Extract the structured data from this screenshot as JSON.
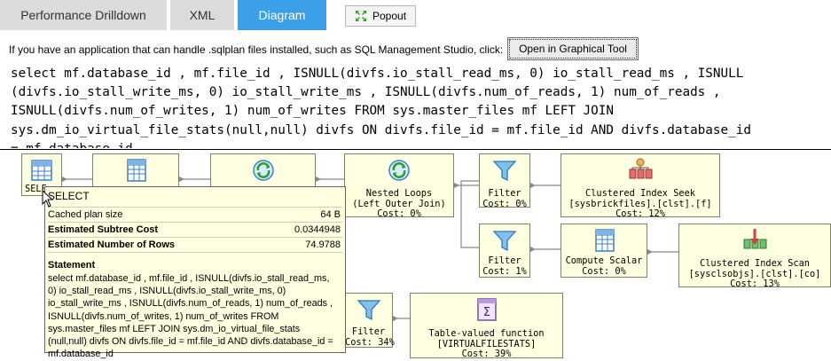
{
  "tabs": [
    {
      "label": "Performance Drilldown",
      "active": false
    },
    {
      "label": "XML",
      "active": false
    },
    {
      "label": "Diagram",
      "active": true
    }
  ],
  "popout": {
    "label": "Popout",
    "icon": "popout-arrows-icon"
  },
  "hint_text": "If you have an application that can handle .sqlplan files installed, such as SQL Management Studio, click:",
  "open_button": "Open in Graphical Tool",
  "sql_lines": [
    "select mf.database_id , mf.file_id , ISNULL(divfs.io_stall_read_ms, 0) io_stall_read_ms , ISNULL",
    "(divfs.io_stall_write_ms, 0) io_stall_write_ms , ISNULL(divfs.num_of_reads, 1) num_of_reads ,",
    "ISNULL(divfs.num_of_writes, 1) num_of_writes FROM sys.master_files mf LEFT JOIN",
    "sys.dm_io_virtual_file_stats(null,null) divfs ON divfs.file_id = mf.file_id AND divfs.database_id",
    "= mf.database_id"
  ],
  "nodes": {
    "select": {
      "lines": [
        "SELE"
      ],
      "icon": "select-icon"
    },
    "compute_top": {
      "lines": [],
      "icon": "compute-scalar-icon"
    },
    "merge_top": {
      "lines": [],
      "icon": "nested-loops-icon"
    },
    "nested_loops": {
      "lines": [
        "Nested Loops",
        "(Left Outer Join)",
        "Cost: 0%"
      ],
      "icon": "nested-loops-icon"
    },
    "filter_top": {
      "lines": [
        "Filter",
        "Cost: 0%"
      ],
      "icon": "filter-icon"
    },
    "ci_seek": {
      "lines": [
        "Clustered Index Seek",
        "[sysbrickfiles].[clst].[f]",
        "Cost: 12%"
      ],
      "icon": "clustered-index-seek-icon"
    },
    "filter_mid": {
      "lines": [
        "Filter",
        "Cost: 1%"
      ],
      "icon": "filter-icon"
    },
    "compute_scalar": {
      "lines": [
        "Compute Scalar",
        "Cost: 0%"
      ],
      "icon": "compute-scalar-icon"
    },
    "ci_scan": {
      "lines": [
        "Clustered Index Scan",
        "[sysclsobjs].[clst].[co]",
        "Cost: 13%"
      ],
      "icon": "clustered-index-scan-icon"
    },
    "filter_bottom": {
      "lines": [
        "Filter",
        "Cost: 34%"
      ],
      "icon": "filter-icon"
    },
    "tvf": {
      "lines": [
        "Table-valued function",
        "[VIRTUALFILESTATS]",
        "Cost: 39%"
      ],
      "icon": "table-valued-function-icon"
    }
  },
  "tooltip": {
    "title": "SELECT",
    "rows": [
      {
        "key": "Cached plan size",
        "value": "64 B"
      },
      {
        "key": "Estimated Subtree Cost",
        "value": "0.0344948"
      },
      {
        "key": "Estimated Number of Rows",
        "value": "74.9788"
      }
    ],
    "statement_heading": "Statement",
    "statement_lines": [
      "select mf.database_id , mf.file_id , ISNULL(divfs.io_stall_read_ms,",
      "0) io_stall_read_ms , ISNULL(divfs.io_stall_write_ms, 0)",
      "io_stall_write_ms , ISNULL(divfs.num_of_reads, 1) num_of_reads ,",
      "ISNULL(divfs.num_of_writes, 1) num_of_writes FROM",
      "sys.master_files mf LEFT JOIN sys.dm_io_virtual_file_stats",
      "(null,null) divfs ON divfs.file_id = mf.file_id AND divfs.database_id =",
      "mf.database_id"
    ]
  },
  "colors": {
    "active_tab": "#3ca0e8",
    "node_bg": "#ffffe1",
    "tab_bg": "#dcdcdc"
  }
}
